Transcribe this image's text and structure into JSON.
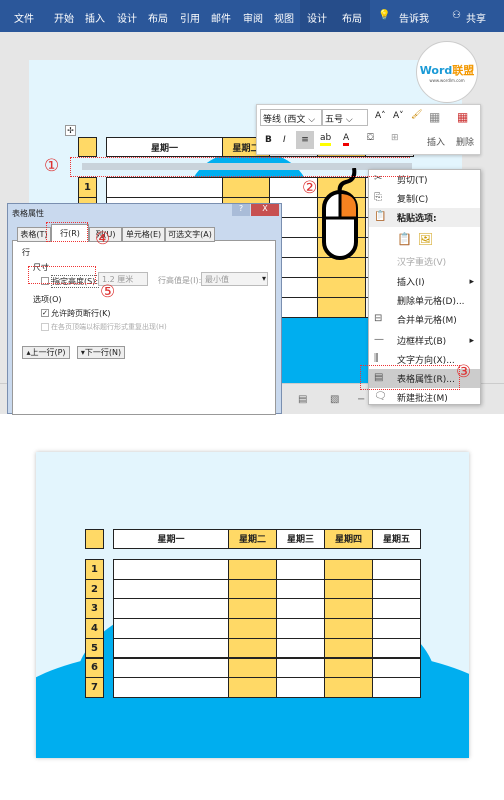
{
  "ribbon": {
    "tabs": [
      "文件",
      "开始",
      "插入",
      "设计",
      "布局",
      "引用",
      "邮件",
      "审阅",
      "视图",
      "设计",
      "布局"
    ],
    "tell_me": "告诉我",
    "share": "共享",
    "color": "#2b579a"
  },
  "logo": {
    "text": "Word联盟",
    "sub": "www.wordlm.com"
  },
  "table": {
    "headers": [
      "星期一",
      "星期二",
      "星期三",
      "星期四",
      "星期五"
    ],
    "rows": [
      "1",
      "2",
      "3",
      "4",
      "5",
      "6",
      "7"
    ],
    "highlight_color": "#ffd966"
  },
  "mini_toolbar": {
    "font": "等线 (西文",
    "size": "五号",
    "bold": "B",
    "italic": "I",
    "insert": "插入",
    "delete": "删除"
  },
  "context_menu": {
    "items": [
      "剪切(T)",
      "复制(C)",
      "粘贴选项:",
      "汉字重选(V)",
      "插入(I)",
      "删除单元格(D)...",
      "合并单元格(M)",
      "边框样式(B)",
      "文字方向(X)...",
      "表格属性(R)...",
      "新建批注(M)"
    ]
  },
  "dialog": {
    "title": "表格属性",
    "tabs": [
      "表格(T)",
      "行(R)",
      "列(U)",
      "单元格(E)",
      "可选文字(A)"
    ],
    "section": "行",
    "size_label": "尺寸",
    "specify_height": "指定高度(S):",
    "height_value": "1.2 厘米",
    "row_height_label": "行高值是(I):",
    "row_height_value": "最小值",
    "options_label": "选项(O)",
    "allow_break": "允许跨页断行(K)",
    "repeat_header": "在各页顶端以标题行形式重复出现(H)",
    "prev_row": "上一行(P)",
    "next_row": "下一行(N)",
    "help": "?",
    "close": "X"
  },
  "annotations": [
    "①",
    "②",
    "③",
    "④",
    "⑤"
  ]
}
